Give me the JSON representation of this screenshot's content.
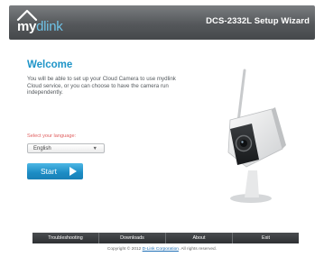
{
  "header": {
    "logo": {
      "my": "my",
      "dlink": "dlink"
    },
    "title": "DCS-2332L Setup Wizard"
  },
  "welcome": {
    "title": "Welcome",
    "intro": "You will be able to set up your Cloud Camera to use mydlink Cloud service, or you can choose to have the camera run independently."
  },
  "language": {
    "label": "Select your language:",
    "selected": "English"
  },
  "start_button": {
    "label": "Start"
  },
  "footer": {
    "items": [
      "Troubleshooting",
      "Downloads",
      "About",
      "Exit"
    ],
    "copyright_prefix": "Copyright © 2012",
    "copyright_link": "D-Link Corporation",
    "copyright_suffix": ". All rights reserved."
  },
  "colors": {
    "accent": "#1f95c8",
    "header_bg": "#55585b",
    "label_red": "#e06060"
  },
  "icons": [
    "house-roof-logo-icon",
    "chevron-down-icon",
    "arrow-right-icon",
    "camera-illustration"
  ]
}
